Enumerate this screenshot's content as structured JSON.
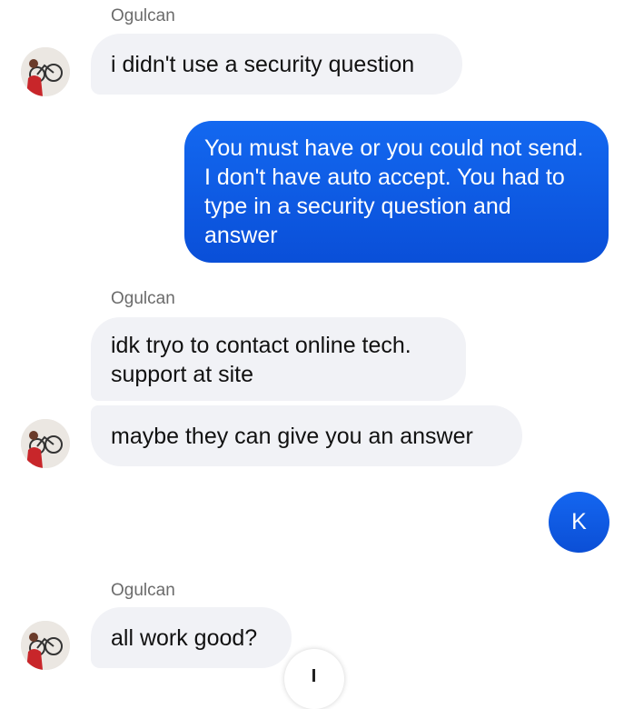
{
  "conversation": {
    "messages": [
      {
        "sender": "Ogulcan",
        "text": "i didn't use a security question"
      },
      {
        "text": "You must have or you could not send. I don't have auto accept. You had to type in a security question and answer"
      },
      {
        "sender": "Ogulcan",
        "text": "idk tryo to contact online tech. support at site"
      },
      {
        "text": "maybe they can give you an answer"
      },
      {
        "sender": "Ogulcan",
        "text": "all work good?"
      }
    ],
    "self_avatar_initial": "K",
    "colors": {
      "outgoing_bubble": "#0b57e6",
      "incoming_bubble": "#f1f2f6",
      "sender_name": "#6b6b6b"
    },
    "icons": [
      "contact-avatar-icon",
      "arrow-down-icon"
    ]
  }
}
